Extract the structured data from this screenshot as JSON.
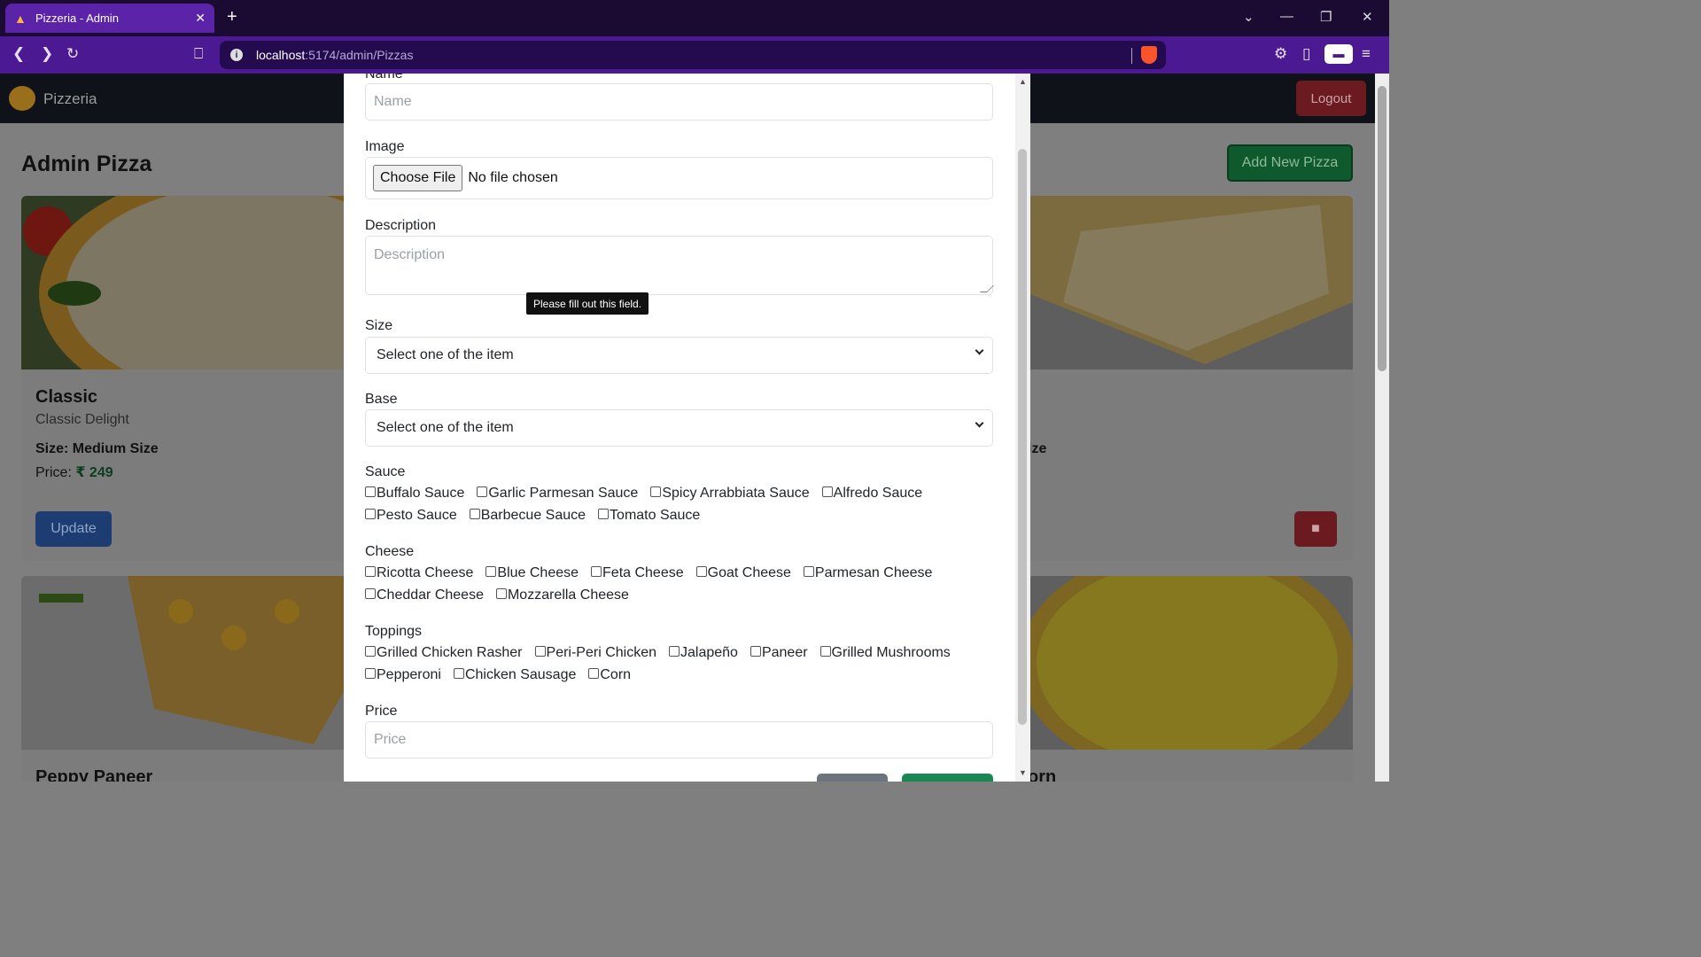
{
  "browser": {
    "tab_title": "Pizzeria - Admin",
    "url_host": "localhost",
    "url_path": ":5174/admin/Pizzas"
  },
  "app": {
    "brand": "Pizzeria",
    "logout_label": "Logout",
    "page_title": "Admin Pizza",
    "add_new_label": "Add New Pizza"
  },
  "cards": [
    {
      "name": "Classic",
      "subtitle": "Classic Delight",
      "size": "Size: Medium Size",
      "price_label": "Price: ",
      "price_value": "₹ 249",
      "update_label": "Update"
    },
    {
      "name": "Peppy Paneer",
      "size_partial": "ize",
      "name2_partial": "orn"
    }
  ],
  "modal": {
    "name_label": "Name",
    "name_placeholder": "Name",
    "image_label": "Image",
    "choose_file": "Choose File",
    "no_file": "No file chosen",
    "description_label": "Description",
    "description_placeholder": "Description",
    "tooltip": "Please fill out this field.",
    "size_label": "Size",
    "size_selected": "Select one of the item",
    "base_label": "Base",
    "base_selected": "Select one of the item",
    "sauce_label": "Sauce",
    "sauces_row1": [
      "Buffalo Sauce",
      "Garlic Parmesan Sauce",
      "Spicy Arrabbiata Sauce",
      "Alfredo Sauce"
    ],
    "sauces_row2": [
      "Pesto Sauce",
      "Barbecue Sauce",
      "Tomato Sauce"
    ],
    "cheese_label": "Cheese",
    "cheese_row1": [
      "Ricotta Cheese",
      "Blue Cheese",
      "Feta Cheese",
      "Goat Cheese",
      "Parmesan Cheese"
    ],
    "cheese_row2": [
      "Cheddar Cheese",
      "Mozzarella Cheese"
    ],
    "toppings_label": "Toppings",
    "toppings_row1": [
      "Grilled Chicken Rasher",
      "Peri-Peri Chicken",
      "Jalapeño",
      "Paneer",
      "Grilled Mushrooms"
    ],
    "toppings_row2": [
      "Pepperoni",
      "Chicken Sausage",
      "Corn"
    ],
    "price_label": "Price",
    "price_placeholder": "Price"
  },
  "colors": {
    "tab_active": "#5b23a8",
    "addr_bar": "#4b1a92",
    "success": "#198754",
    "danger": "#dc3545",
    "primary": "#0d6efd"
  }
}
